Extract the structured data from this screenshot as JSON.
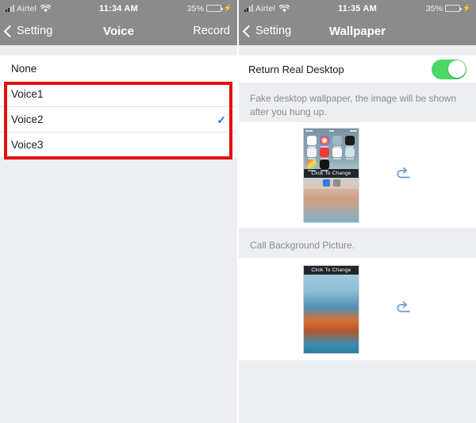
{
  "screens": {
    "left": {
      "status_bar": {
        "signal_icon": "signal-bars-icon",
        "carrier": "Airtel",
        "wifi_icon": "wifi-icon",
        "time": "11:34 AM",
        "battery_percent": "35%",
        "battery_icon": "battery-icon",
        "charging_icon": "lightning-bolt-icon"
      },
      "nav": {
        "back_icon": "chevron-left-icon",
        "back_label": "Setting",
        "title": "Voice",
        "action_label": "Record"
      },
      "none_row": {
        "label": "None"
      },
      "voices": [
        {
          "label": "Voice1",
          "selected": false
        },
        {
          "label": "Voice2",
          "selected": true
        },
        {
          "label": "Voice3",
          "selected": false
        }
      ],
      "check_icon": "✓",
      "highlight_color": "#e50f0f",
      "check_color": "#1878f0"
    },
    "right": {
      "status_bar": {
        "signal_icon": "signal-bars-icon",
        "carrier": "Airtel",
        "wifi_icon": "wifi-icon",
        "time": "11:35 AM",
        "battery_percent": "35%",
        "battery_icon": "battery-icon",
        "charging_icon": "lightning-bolt-icon"
      },
      "nav": {
        "back_icon": "chevron-left-icon",
        "back_label": "Setting",
        "title": "Wallpaper"
      },
      "toggle": {
        "label": "Return Real Desktop",
        "state": "on",
        "on_color": "#4cd867"
      },
      "desktop_note": "Fake desktop wallpaper, the image will be shown after you hung up.",
      "desktop_thumb": {
        "band_label": "Click To Change",
        "reset_icon": "undo-arrow-icon"
      },
      "callbg_note": "Call Background Picture.",
      "callbg_thumb": {
        "band_label": "Click To Change",
        "reset_icon": "undo-arrow-icon"
      },
      "highlight_color": "#e50f0f"
    }
  }
}
